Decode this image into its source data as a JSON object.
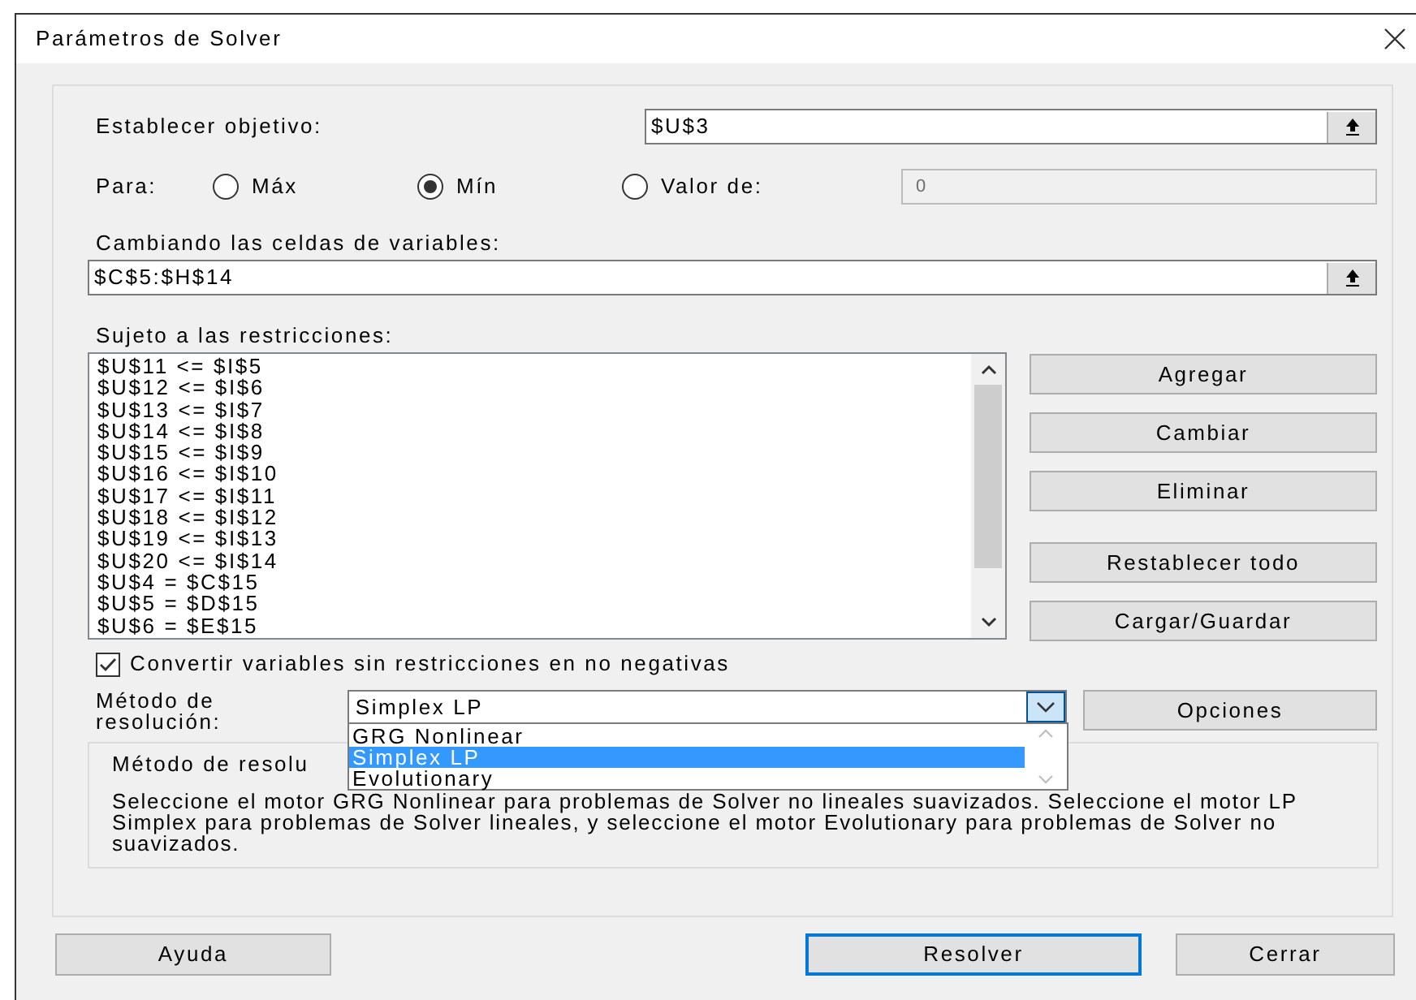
{
  "window": {
    "title": "Parámetros de Solver"
  },
  "objective": {
    "label": "Establecer objetivo:",
    "value": "$U$3"
  },
  "goal": {
    "label": "Para:",
    "options": [
      {
        "label": "Máx",
        "selected": false
      },
      {
        "label": "Mín",
        "selected": true
      },
      {
        "label": "Valor de:",
        "selected": false
      }
    ],
    "value_field": {
      "value": "0",
      "disabled": true
    }
  },
  "variables": {
    "label": "Cambiando las celdas de variables:",
    "value": "$C$5:$H$14"
  },
  "constraints": {
    "label": "Sujeto a las restricciones:",
    "items": [
      "$U$11 <= $I$5",
      "$U$12 <= $I$6",
      "$U$13 <= $I$7",
      "$U$14 <= $I$8",
      "$U$15 <= $I$9",
      "$U$16 <= $I$10",
      "$U$17 <= $I$11",
      "$U$18 <= $I$12",
      "$U$19 <= $I$13",
      "$U$20 <= $I$14",
      "$U$4 = $C$15",
      "$U$5 = $D$15",
      "$U$6 = $E$15"
    ]
  },
  "side_buttons": [
    {
      "label": "Agregar"
    },
    {
      "label": "Cambiar"
    },
    {
      "label": "Eliminar"
    },
    {
      "label": "Restablecer todo"
    },
    {
      "label": "Cargar/Guardar"
    }
  ],
  "nonnegative": {
    "label": "Convertir variables sin restricciones en no negativas",
    "checked": true
  },
  "method": {
    "label": "Método de resolución:",
    "value": "Simplex LP",
    "expanded": true,
    "options": [
      {
        "label": "GRG Nonlinear",
        "selected": false
      },
      {
        "label": "Simplex LP",
        "selected": true
      },
      {
        "label": "Evolutionary",
        "selected": false
      }
    ],
    "options_button": "Opciones"
  },
  "description": {
    "title": "Método de resolu",
    "text": "Seleccione el motor GRG Nonlinear para problemas de Solver no lineales suavizados. Seleccione el motor LP Simplex para problemas de Solver lineales, y seleccione el motor Evolutionary para problemas de Solver no suavizados."
  },
  "footer_buttons": [
    {
      "label": "Ayuda",
      "default": false
    },
    {
      "label": "Resolver",
      "default": true
    },
    {
      "label": "Cerrar",
      "default": false
    }
  ]
}
